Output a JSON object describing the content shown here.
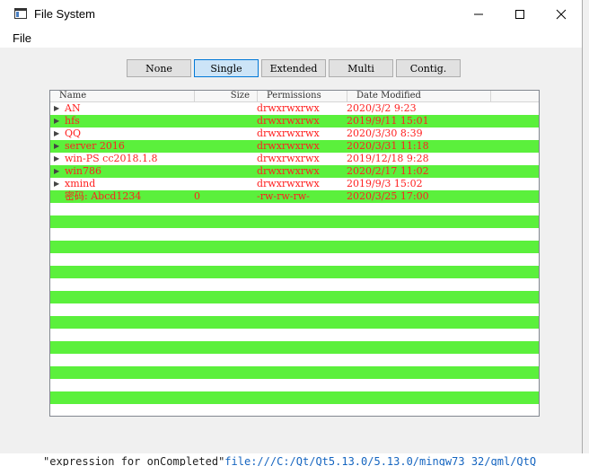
{
  "window": {
    "title": "File System"
  },
  "menu": {
    "file_label": "File"
  },
  "mode_buttons": [
    {
      "label": "None",
      "selected": false
    },
    {
      "label": "Single",
      "selected": true
    },
    {
      "label": "Extended",
      "selected": false
    },
    {
      "label": "Multi",
      "selected": false
    },
    {
      "label": "Contig.",
      "selected": false
    }
  ],
  "list": {
    "columns": [
      "Name",
      "Size",
      "Permissions",
      "Date Modified"
    ],
    "rows": [
      {
        "name": "AN",
        "size": "",
        "permissions": "drwxrwxrwx",
        "modified": "2020/3/2 9:23",
        "expandable": true
      },
      {
        "name": "hfs",
        "size": "",
        "permissions": "drwxrwxrwx",
        "modified": "2019/9/11 15:01",
        "expandable": true
      },
      {
        "name": "QQ",
        "size": "",
        "permissions": "drwxrwxrwx",
        "modified": "2020/3/30 8:39",
        "expandable": true
      },
      {
        "name": "server 2016",
        "size": "",
        "permissions": "drwxrwxrwx",
        "modified": "2020/3/31 11:18",
        "expandable": true
      },
      {
        "name": "win-PS cc2018.1.8",
        "size": "",
        "permissions": "drwxrwxrwx",
        "modified": "2019/12/18 9:28",
        "expandable": true
      },
      {
        "name": "win786",
        "size": "",
        "permissions": "drwxrwxrwx",
        "modified": "2020/2/17 11:02",
        "expandable": true
      },
      {
        "name": "xmind",
        "size": "",
        "permissions": "drwxrwxrwx",
        "modified": "2019/9/3 15:02",
        "expandable": true
      },
      {
        "name": "密码: Abcd1234",
        "size": "0",
        "permissions": "-rw-rw-rw-",
        "modified": "2020/3/25 17:00",
        "expandable": false
      }
    ],
    "text_color": "#ff2020",
    "alt_row_color": "#5bf03c"
  },
  "background": {
    "bottom_text": "\"expression for onCompleted\"",
    "bottom_link": "file:///C:/Qt/Qt5.13.0/5.13.0/mingw73_32/qml/QtQ"
  }
}
